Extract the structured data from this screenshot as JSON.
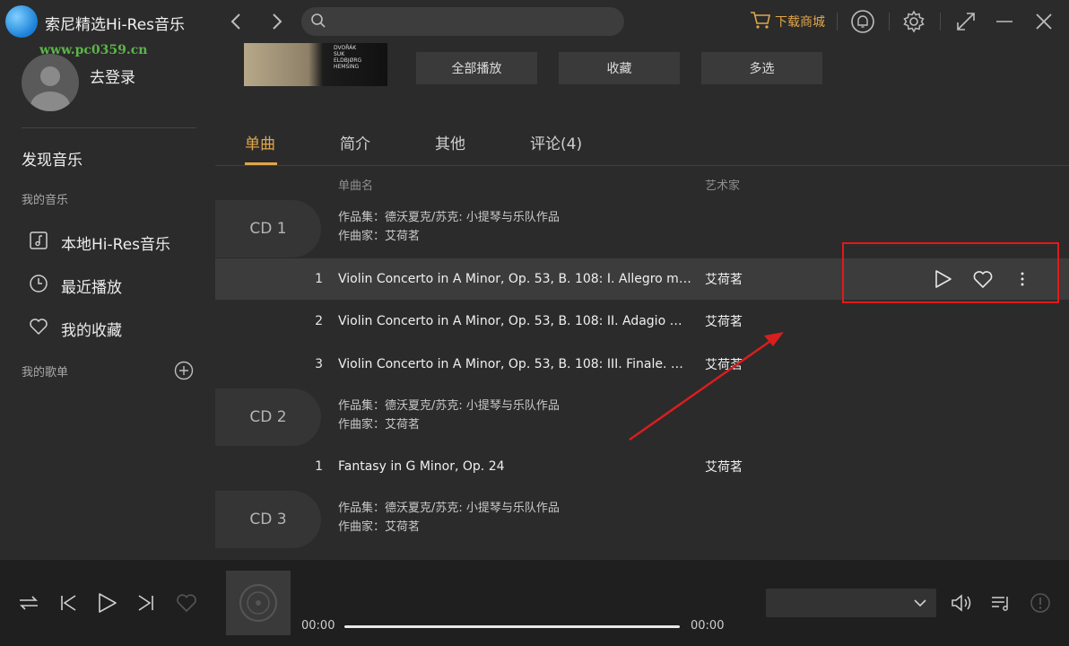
{
  "window": {
    "title": "索尼精选Hi-Res音乐",
    "watermark_url": "www.pc0359.cn",
    "store_label": "下载商城",
    "accent": "#e0a64a"
  },
  "sidebar": {
    "login": "去登录",
    "discover": "发现音乐",
    "my_music": "我的音乐",
    "items": [
      {
        "label": "本地Hi-Res音乐",
        "icon": "music-file-icon"
      },
      {
        "label": "最近播放",
        "icon": "clock-icon"
      },
      {
        "label": "我的收藏",
        "icon": "heart-icon"
      }
    ],
    "my_playlists": "我的歌单"
  },
  "album": {
    "cover_text": [
      "DVOŘÁK",
      "SUK",
      "ELDBJØRG HEMSING"
    ],
    "actions": [
      "全部播放",
      "收藏",
      "多选"
    ]
  },
  "tabs": [
    "单曲",
    "简介",
    "其他",
    "评论(4)"
  ],
  "columns": {
    "title": "单曲名",
    "artist": "艺术家"
  },
  "discs": [
    {
      "label": "CD 1",
      "meta_album": "作品集：德沃夏克/苏克: 小提琴与乐队作品",
      "meta_composer": "作曲家：艾荷茗",
      "tracks": [
        {
          "num": "1",
          "title": "Violin Concerto in A Minor, Op. 53, B. 108: I. Allegro ma non troppo",
          "artist": "艾荷茗"
        },
        {
          "num": "2",
          "title": "Violin Concerto in A Minor, Op. 53, B. 108: II. Adagio ma non troppo",
          "artist": "艾荷茗"
        },
        {
          "num": "3",
          "title": "Violin Concerto in A Minor, Op. 53, B. 108: III. Finale. Allegro giocoso",
          "artist": "艾荷茗"
        }
      ]
    },
    {
      "label": "CD 2",
      "meta_album": "作品集：德沃夏克/苏克: 小提琴与乐队作品",
      "meta_composer": "作曲家：艾荷茗",
      "tracks": [
        {
          "num": "1",
          "title": "Fantasy in G Minor, Op. 24",
          "artist": "艾荷茗"
        }
      ]
    },
    {
      "label": "CD 3",
      "meta_album": "作品集：德沃夏克/苏克: 小提琴与乐队作品",
      "meta_composer": "作曲家：艾荷茗",
      "tracks": []
    }
  ],
  "player": {
    "time_current": "00:00",
    "time_total": "00:00",
    "quality": ""
  }
}
